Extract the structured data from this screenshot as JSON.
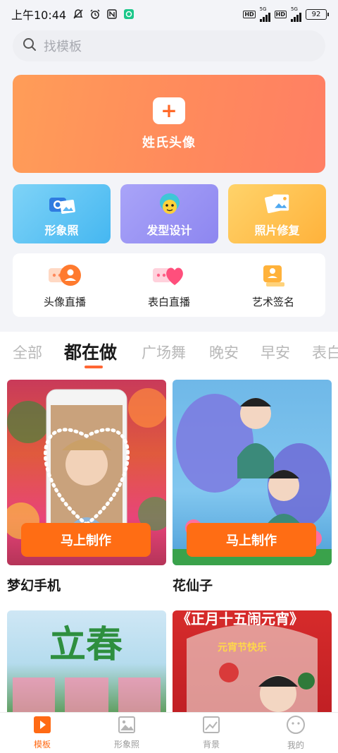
{
  "status_bar": {
    "time": "上午10:44",
    "hd1": "HD",
    "net1": "5G",
    "hd2": "HD",
    "net2": "5G",
    "battery": "92"
  },
  "search": {
    "placeholder": "找模板"
  },
  "banner": {
    "title": "姓氏头像"
  },
  "features": [
    {
      "label": "形象照"
    },
    {
      "label": "发型设计"
    },
    {
      "label": "照片修复"
    }
  ],
  "quick_items": [
    {
      "label": "头像直播"
    },
    {
      "label": "表白直播"
    },
    {
      "label": "艺术签名"
    }
  ],
  "tabs": [
    "全部",
    "都在做",
    "广场舞",
    "晚安",
    "早安",
    "表白"
  ],
  "active_tab": "都在做",
  "templates": [
    {
      "title": "梦幻手机",
      "button": "马上制作"
    },
    {
      "title": "花仙子",
      "button": "马上制作"
    },
    {
      "title": "",
      "art_text": "立春"
    },
    {
      "title": "",
      "art_text": "《正月十五闹元宵》",
      "sub_text": "元宵节快乐"
    }
  ],
  "bottom_nav": [
    {
      "label": "模板",
      "active": true
    },
    {
      "label": "形象照",
      "active": false
    },
    {
      "label": "背景",
      "active": false
    },
    {
      "label": "我的",
      "active": false
    }
  ],
  "colors": {
    "accent": "#ff6d14",
    "banner": "#ff8a5c"
  }
}
